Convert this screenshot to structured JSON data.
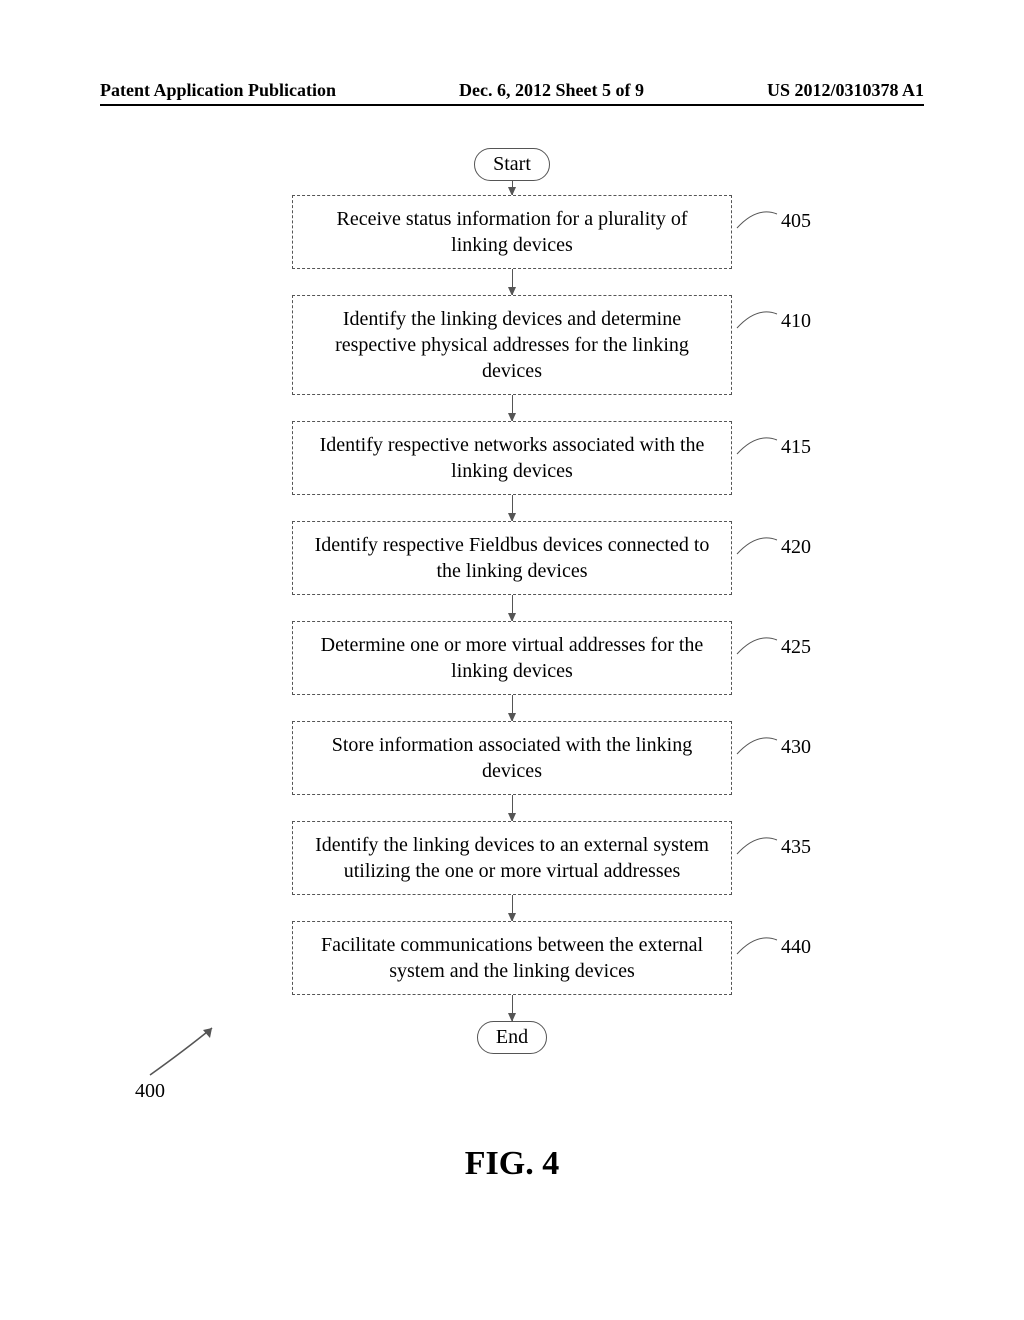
{
  "header": {
    "left": "Patent Application Publication",
    "center": "Dec. 6, 2012  Sheet 5 of 9",
    "right": "US 2012/0310378 A1"
  },
  "flowchart": {
    "start": "Start",
    "end": "End",
    "steps": [
      {
        "ref": "405",
        "text": "Receive status information for a plurality of linking devices"
      },
      {
        "ref": "410",
        "text": "Identify the linking devices and determine respective physical addresses for the linking devices"
      },
      {
        "ref": "415",
        "text": "Identify respective networks associated with the linking devices"
      },
      {
        "ref": "420",
        "text": "Identify respective Fieldbus devices connected to the linking devices"
      },
      {
        "ref": "425",
        "text": "Determine one or more virtual addresses for the linking devices"
      },
      {
        "ref": "430",
        "text": "Store information associated with the linking devices"
      },
      {
        "ref": "435",
        "text": "Identify the linking devices to an external system utilizing the one or more virtual addresses"
      },
      {
        "ref": "440",
        "text": "Facilitate communications between the external system and the linking devices"
      }
    ]
  },
  "figure": {
    "overall_ref": "400",
    "caption": "FIG. 4"
  }
}
